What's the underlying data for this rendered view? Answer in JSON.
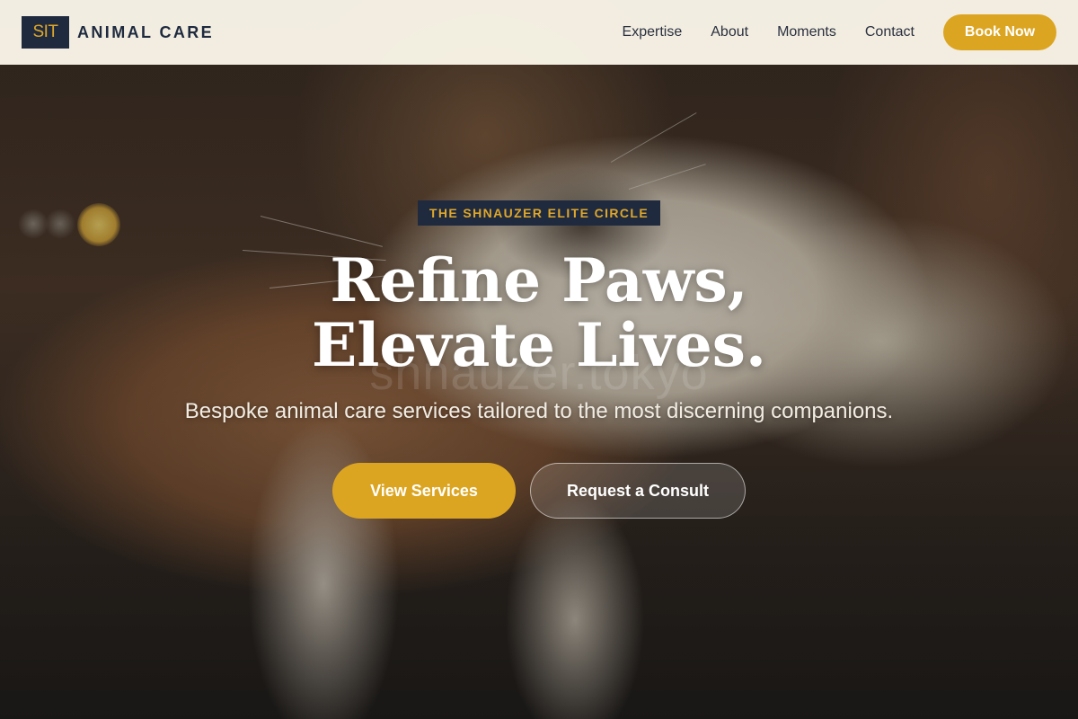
{
  "brand": {
    "mark": "SIT",
    "name": "ANIMAL CARE"
  },
  "nav": {
    "items": [
      "Expertise",
      "About",
      "Moments",
      "Contact"
    ],
    "book_label": "Book Now"
  },
  "hero": {
    "badge": "THE SHNAUZER ELITE CIRCLE",
    "headline_line1": "Refine Paws,",
    "headline_line2": "Elevate Lives.",
    "watermark": "shnauzer.tokyo",
    "subtitle": "Bespoke animal care services tailored to the most discerning companions.",
    "primary_cta": "View Services",
    "secondary_cta": "Request a Consult"
  },
  "colors": {
    "accent": "#dca521",
    "navy": "#1f2a3f",
    "header_bg": "#faf6e8"
  }
}
